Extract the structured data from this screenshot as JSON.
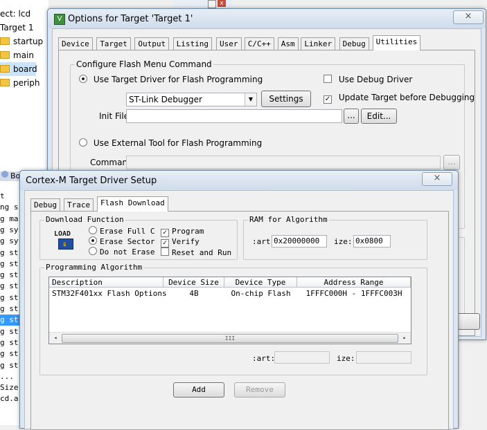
{
  "background": {
    "tree_items": [
      {
        "label": "ect: lcd",
        "folder": false,
        "indent": false,
        "selected": false
      },
      {
        "label": "Target 1",
        "folder": false,
        "indent": false,
        "selected": false
      },
      {
        "label": "startup",
        "folder": true,
        "indent": true,
        "selected": false
      },
      {
        "label": "main",
        "folder": true,
        "indent": true,
        "selected": false
      },
      {
        "label": "board",
        "folder": true,
        "indent": true,
        "selected": true
      },
      {
        "label": "periph",
        "folder": true,
        "indent": true,
        "selected": false
      }
    ],
    "code_header": "Bo",
    "code_lines": [
      "t",
      "ng s",
      "g ma",
      "g sy",
      "g sy",
      "g st",
      "g st",
      "g st",
      "g st",
      "g st",
      "g st",
      "g st",
      "g st",
      "g st",
      "g st",
      "g st",
      "...",
      "Size",
      "cd.a"
    ],
    "selected_code_line": 11
  },
  "options_window": {
    "title": "Options for Target 'Target 1'",
    "close_glyph": "×",
    "tabs": [
      "Device",
      "Target",
      "Output",
      "Listing",
      "User",
      "C/C++",
      "Asm",
      "Linker",
      "Debug",
      "Utilities"
    ],
    "active_tab": "Utilities",
    "group_label": "Configure Flash Menu Command",
    "use_target_driver_label": "Use Target Driver for Flash Programming",
    "driver_select_value": "ST-Link Debugger",
    "settings_button": "Settings",
    "use_debug_driver_label": "Use Debug Driver",
    "update_target_label": "Update Target before Debugging",
    "init_file_label": "Init File:",
    "init_file_value": "",
    "browse_button": "...",
    "edit_button": "Edit...",
    "use_external_tool_label": "Use External Tool for Flash Programming",
    "command_label": "Command:",
    "command_value": "",
    "command_browse_button": "..."
  },
  "driver_window": {
    "title": "Cortex-M Target Driver Setup",
    "close_glyph": "×",
    "tabs": [
      "Debug",
      "Trace",
      "Flash Download"
    ],
    "active_tab": "Flash Download",
    "download_function": {
      "label": "Download Function",
      "icon_text": "LOAD",
      "erase_full_chip": "Erase Full C",
      "erase_sectors": "Erase Sector",
      "do_not_erase": "Do not Erase",
      "program": "Program",
      "verify": "Verify",
      "reset_and_run": "Reset and Run"
    },
    "ram_for_algorithm": {
      "label": "RAM for Algorithm",
      "start_label": ":art:",
      "start_value": "0x20000000",
      "size_label": "ize:",
      "size_value": "0x0800"
    },
    "programming_algorithm": {
      "label": "Programming Algorithm",
      "columns": [
        "Description",
        "Device Size",
        "Device Type",
        "Address Range"
      ],
      "rows": [
        {
          "description": "STM32F401xx Flash Options",
          "size": "4B",
          "type": "On-chip Flash",
          "range": "1FFFC000H - 1FFFC003H"
        }
      ],
      "scroll_left": "◂",
      "scroll_right": "▸",
      "scroll_grip": "III",
      "start_label": ":art:",
      "start_value": "",
      "size_label": "ize:",
      "size_value": ""
    },
    "add_button": "Add",
    "remove_button": "Remove"
  }
}
